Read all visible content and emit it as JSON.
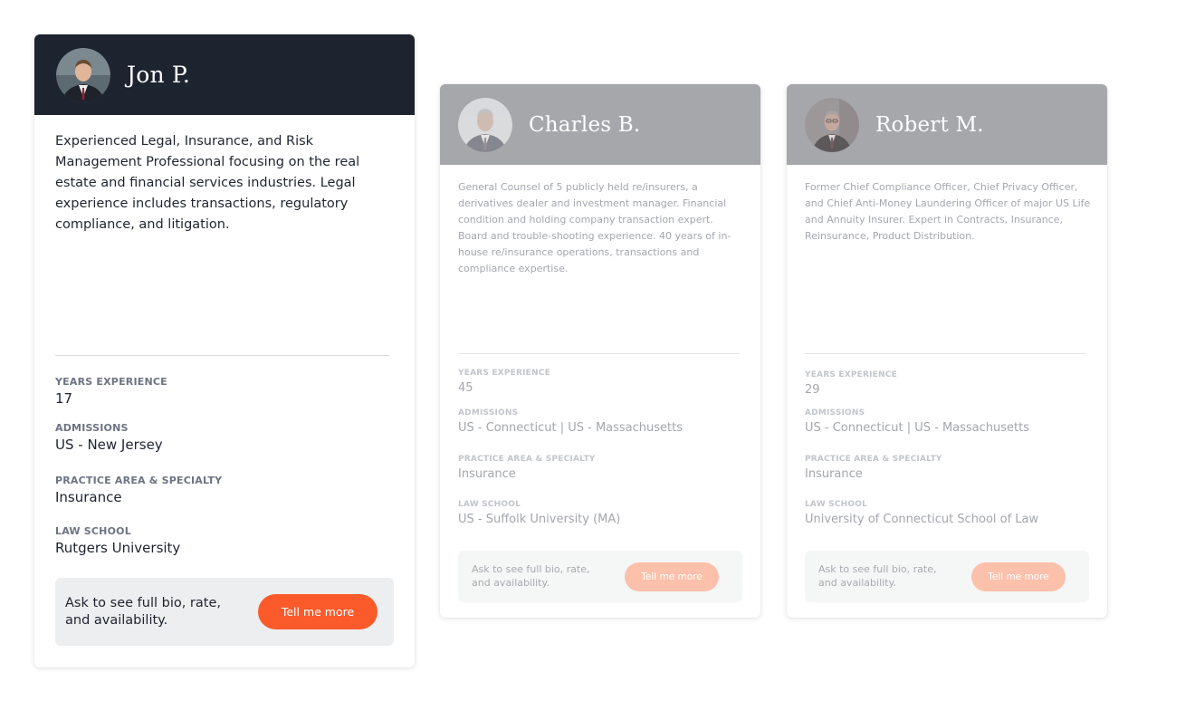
{
  "cards": [
    {
      "name": "Jon P.",
      "bio": "Experienced Legal, Insurance, and Risk Management Professional focusing on the real estate and financial services industries. Legal experience includes transactions, regulatory compliance, and litigation.",
      "fields": [
        {
          "label": "YEARS EXPERIENCE",
          "value": "17"
        },
        {
          "label": "ADMISSIONS",
          "value": "US - New Jersey"
        },
        {
          "label": "PRACTICE AREA & SPECIALTY",
          "value": "Insurance"
        },
        {
          "label": "LAW SCHOOL",
          "value": "Rutgers University"
        }
      ],
      "cta_text": "Ask to see full bio, rate, and availability.",
      "cta_button": "Tell me more"
    },
    {
      "name": "Charles B.",
      "bio": "General Counsel of 5 publicly held re/insurers, a derivatives dealer and investment manager. Financial condition and holding company transaction expert. Board and trouble-shooting experience. 40 years of in-house re/insurance operations, transactions and compliance expertise.",
      "fields": [
        {
          "label": "YEARS EXPERIENCE",
          "value": "45"
        },
        {
          "label": "ADMISSIONS",
          "value": "US - Connecticut | US - Massachusetts"
        },
        {
          "label": "PRACTICE AREA & SPECIALTY",
          "value": "Insurance"
        },
        {
          "label": "LAW SCHOOL",
          "value": "US - Suffolk University (MA)"
        }
      ],
      "cta_text": "Ask to see full bio, rate, and availability.",
      "cta_button": "Tell me more"
    },
    {
      "name": "Robert M.",
      "bio": "Former Chief Compliance Officer, Chief Privacy Officer, and Chief Anti-Money Laundering Officer of major US Life and Annuity Insurer. Expert in Contracts, Insurance, Reinsurance, Product Distribution.",
      "fields": [
        {
          "label": "YEARS EXPERIENCE",
          "value": "29"
        },
        {
          "label": "ADMISSIONS",
          "value": "US - Connecticut | US - Massachusetts"
        },
        {
          "label": "PRACTICE AREA & SPECIALTY",
          "value": "Insurance"
        },
        {
          "label": "LAW SCHOOL",
          "value": "University of Connecticut School of Law"
        }
      ],
      "cta_text": "Ask to see full bio, rate, and availability.",
      "cta_button": "Tell me more"
    }
  ],
  "colors": {
    "header_active": "#1e2330",
    "header_faded": "#a6a7ab",
    "accent": "#fb5a2a",
    "accent_faded": "#fdc0ab"
  },
  "icons": {
    "avatar": "person-portrait"
  }
}
